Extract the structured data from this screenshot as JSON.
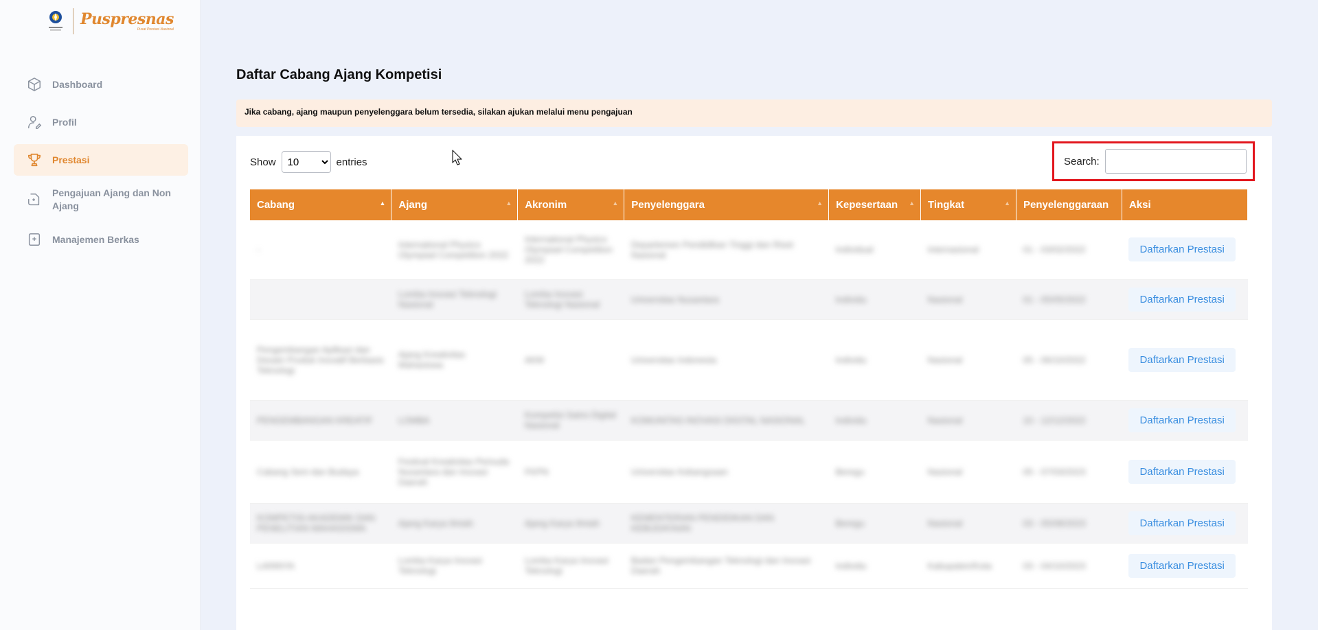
{
  "brand": {
    "name": "Puspresnas",
    "tagline": "Pusat Prestasi Nasional"
  },
  "colors": {
    "accent": "#e6872c",
    "active_bg": "#fdf0e4",
    "link": "#3a8ee0",
    "highlight": "#e2161d"
  },
  "sidebar": {
    "items": [
      {
        "label": "Dashboard",
        "icon": "cube-icon",
        "active": false
      },
      {
        "label": "Profil",
        "icon": "user-edit-icon",
        "active": false
      },
      {
        "label": "Prestasi",
        "icon": "trophy-icon",
        "active": true
      },
      {
        "label": "Pengajuan Ajang dan Non Ajang",
        "icon": "document-add-icon",
        "active": false
      },
      {
        "label": "Manajemen Berkas",
        "icon": "file-plus-icon",
        "active": false
      }
    ]
  },
  "main": {
    "title": "Daftar Cabang Ajang Kompetisi",
    "alert": "Jika cabang, ajang maupun penyelenggara belum tersedia, silakan ajukan melalui menu pengajuan"
  },
  "table_controls": {
    "show_label": "Show",
    "page_length": "10",
    "page_length_options": [
      "10"
    ],
    "entries_label": "entries",
    "search_label": "Search:",
    "search_value": ""
  },
  "table": {
    "columns": [
      "Cabang",
      "Ajang",
      "Akronim",
      "Penyelenggara",
      "Kepesertaan",
      "Tingkat",
      "Penyelenggaraan",
      "Aksi"
    ],
    "action_label": "Daftarkan Prestasi",
    "rows": [
      [
        "-",
        "International Physics Olympiad Competition 2022",
        "International Physics Olympiad Competition 2022",
        "Departemen Pendidikan Tinggi dan Riset Nasional",
        "Individual",
        "Internasional",
        "01 - 03/02/2022"
      ],
      [
        "",
        "Lomba Inovasi Teknologi Nasional",
        "Lomba Inovasi Teknologi Nasional",
        "Universitas Nusantara",
        "Individu",
        "Nasional",
        "01 - 05/05/2022"
      ],
      [
        "Pengembangan Aplikasi dan Desain Produk Inovatif Berbasis Teknologi",
        "Ajang Kreativitas Mahasiswa",
        "AKM",
        "Universitas Indonesia",
        "Individu",
        "Nasional",
        "05 - 06/10/2022"
      ],
      [
        "PENGEMBANGAN KREATIF",
        "LOMBA",
        "Kompetisi Sains Digital Nasional",
        "KOMUNITAS INOVASI DIGITAL NASIONAL",
        "Individu",
        "Nasional",
        "10 - 12/12/2022"
      ],
      [
        "Cabang Seni dan Budaya",
        "Festival Kreativitas Pemuda Nusantara dan Inovasi Daerah",
        "FKPN",
        "Universitas Kebangsaan",
        "Beregu",
        "Nasional",
        "05 - 07/03/2023"
      ],
      [
        "KOMPETISI AKADEMIK DAN PENELITIAN MAHASISWA",
        "Ajang Karya Ilmiah",
        "Ajang Karya Ilmiah",
        "KEMENTERIAN PENDIDIKAN DAN KEBUDAYAAN",
        "Beregu",
        "Nasional",
        "03 - 05/08/2023"
      ],
      [
        "LAINNYA",
        "Lomba Karya Inovasi Teknologi",
        "Lomba Karya Inovasi Teknologi",
        "Badan Pengembangan Teknologi dan Inovasi Daerah",
        "Individu",
        "Kabupaten/Kota",
        "03 - 04/10/2023"
      ]
    ]
  }
}
